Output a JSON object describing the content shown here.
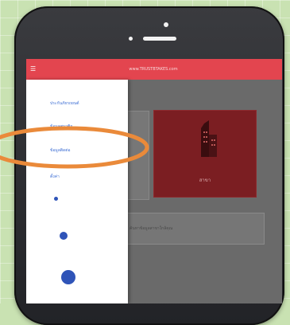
{
  "app": {
    "title": "www.TRUSTBTAKES.com"
  },
  "drawer": {
    "items": [
      {
        "label": "ประกันภัยรถยนต์"
      },
      {
        "label": "ข้อมูลสมาชิก"
      },
      {
        "label": "ข้อมูลติดต่อ"
      },
      {
        "label": "ตั้งค่า"
      }
    ]
  },
  "content": {
    "tile_label": "สาขา",
    "bar_text": "ค้นหาข้อมูลสาขาใกล้คุณ"
  },
  "annotation": {
    "ring_color": "#ea8a3a"
  },
  "icons": {
    "menu": "hamburger-icon",
    "tile": "building-icon"
  },
  "colors": {
    "header": "#e3454f",
    "tile": "#7b1e22",
    "drawer_link": "#3d6ed4"
  }
}
